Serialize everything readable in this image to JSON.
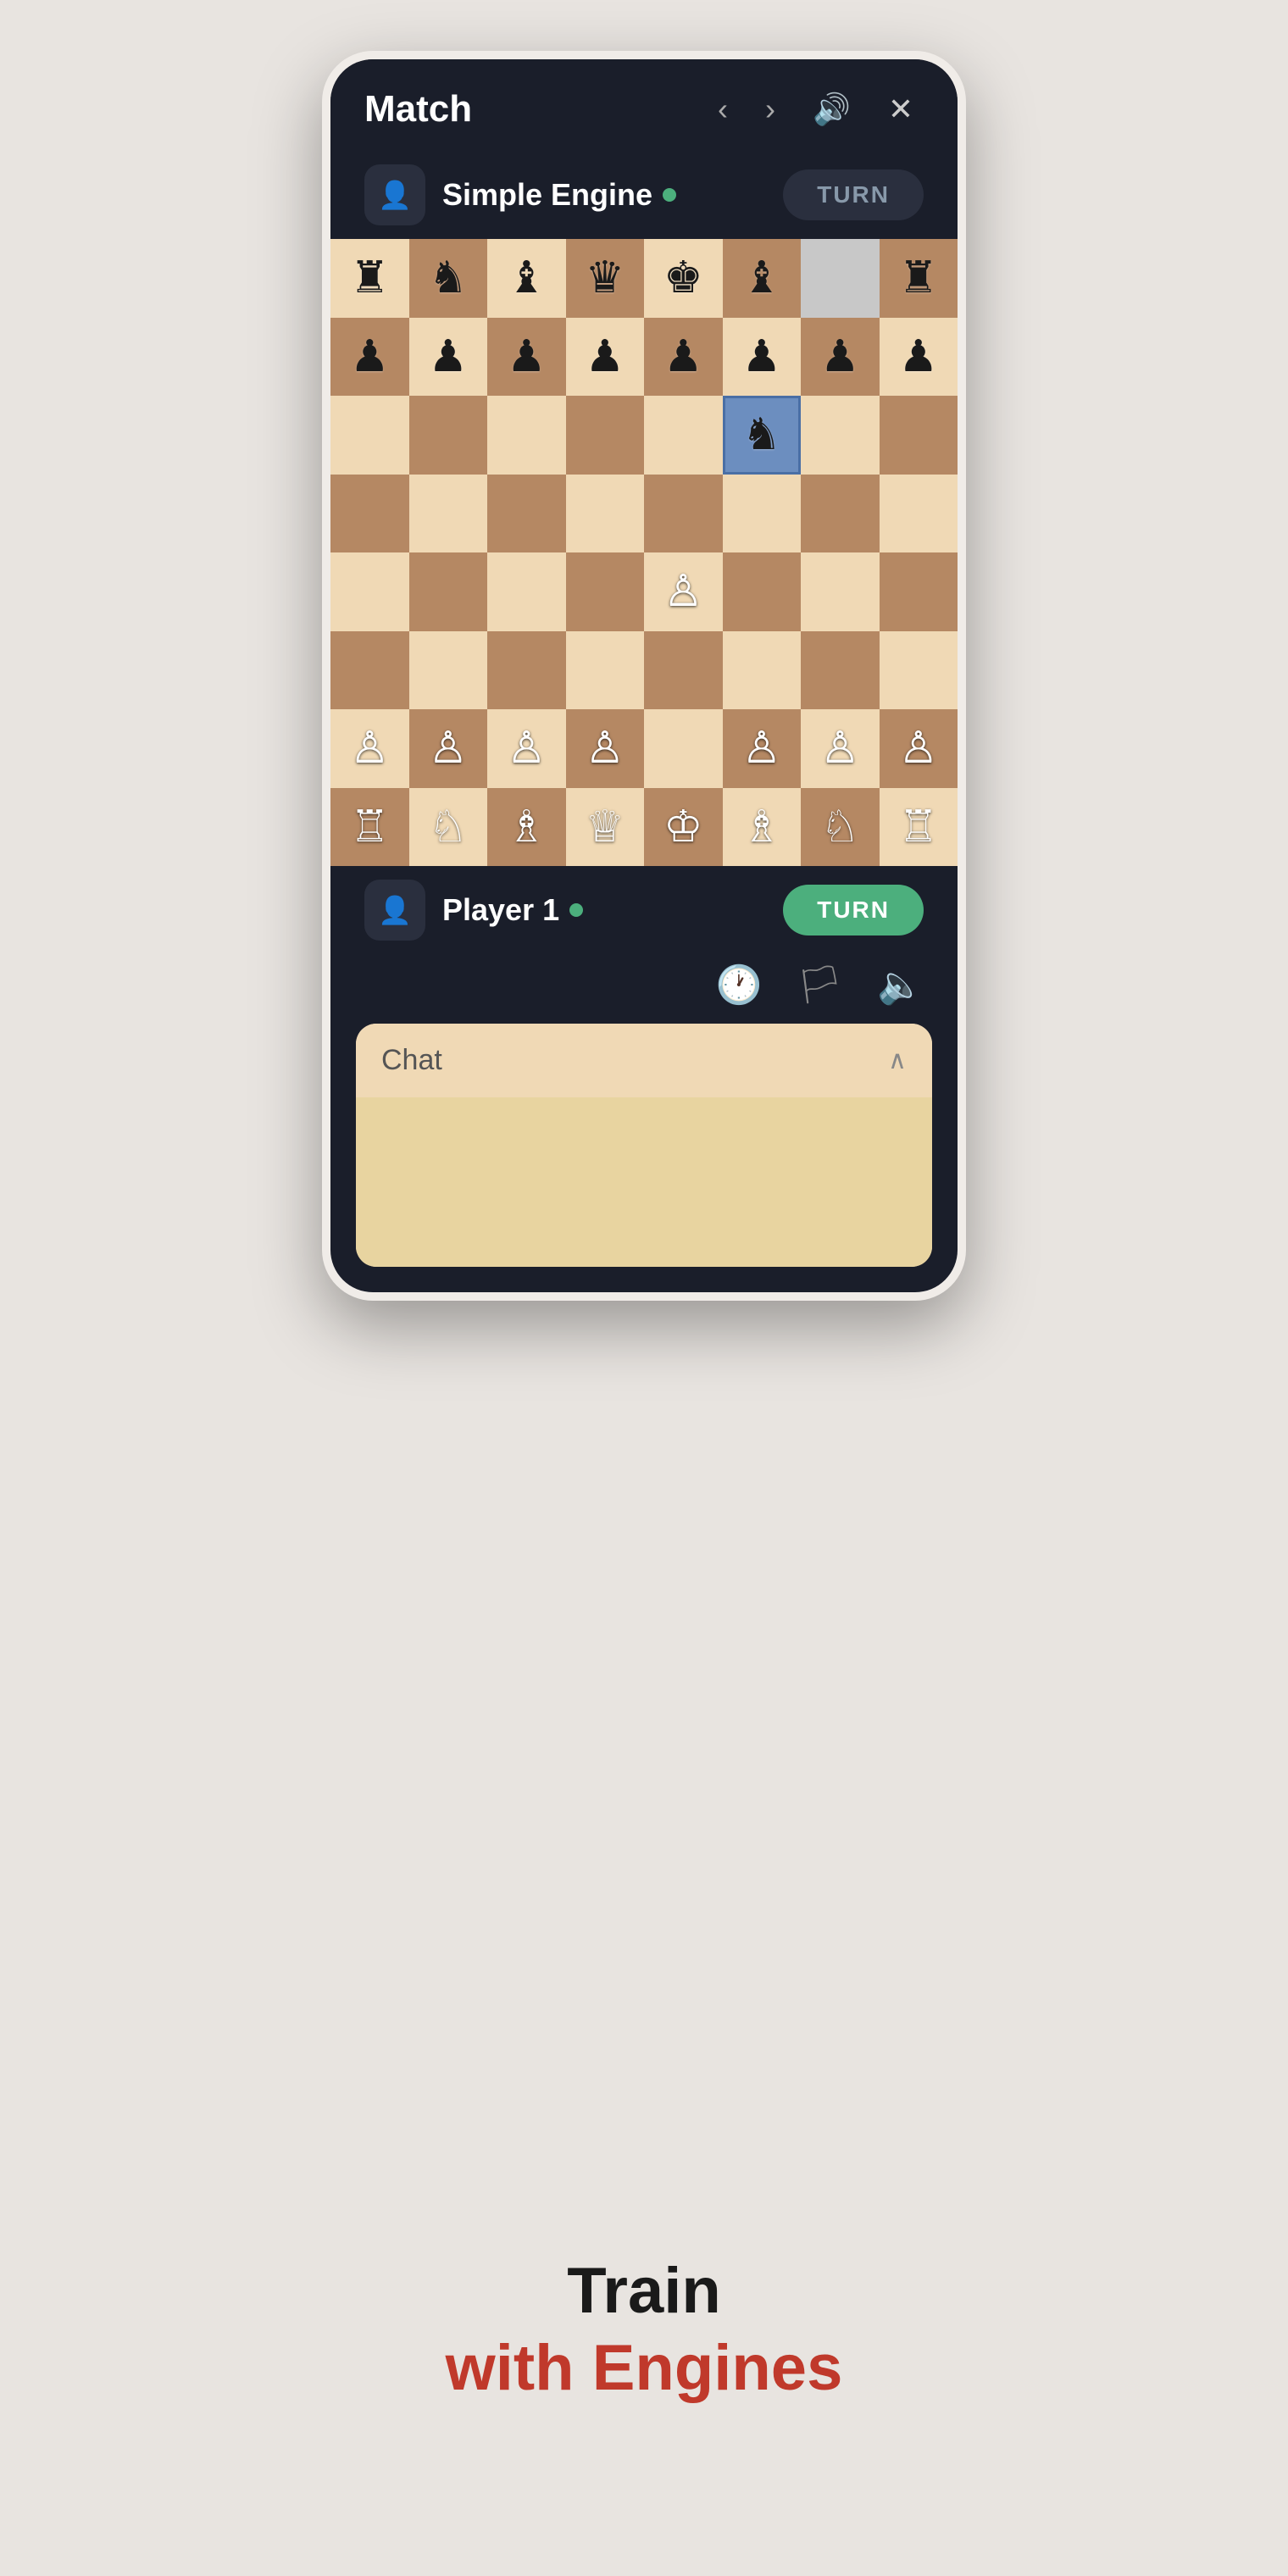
{
  "header": {
    "title": "Match",
    "back_icon": "‹",
    "forward_icon": "›",
    "sound_icon": "🔊",
    "close_icon": "✕"
  },
  "opponent": {
    "name": "Simple Engine",
    "status": "online",
    "turn_label": "TURN",
    "avatar_icon": "👤"
  },
  "player": {
    "name": "Player 1",
    "status": "online",
    "turn_label": "TURN",
    "avatar_icon": "👤"
  },
  "chat": {
    "label": "Chat",
    "toggle_icon": "∧"
  },
  "tagline": {
    "line1": "Train",
    "line2": "with Engines"
  },
  "board": {
    "rows": [
      [
        "♜",
        "♞",
        "♝",
        "♛",
        "♚",
        "♝",
        "",
        "♜"
      ],
      [
        "♟",
        "♟",
        "♟",
        "♟",
        "♟",
        "♟",
        "♟",
        "♟"
      ],
      [
        "",
        "",
        "",
        "",
        "",
        "♞",
        "",
        ""
      ],
      [
        "",
        "",
        "",
        "",
        "",
        "",
        "",
        ""
      ],
      [
        "",
        "",
        "",
        "",
        "♙",
        "",
        "",
        ""
      ],
      [
        "",
        "",
        "",
        "",
        "",
        "",
        "",
        ""
      ],
      [
        "♙",
        "♙",
        "♙",
        "♙",
        "",
        "♙",
        "♙",
        "♙"
      ],
      [
        "♖",
        "♘",
        "♗",
        "♕",
        "♔",
        "♗",
        "♘",
        "♖"
      ]
    ],
    "selected_cell": {
      "row": 2,
      "col": 5
    },
    "highlighted_cell": {
      "row": 0,
      "col": 6
    }
  }
}
